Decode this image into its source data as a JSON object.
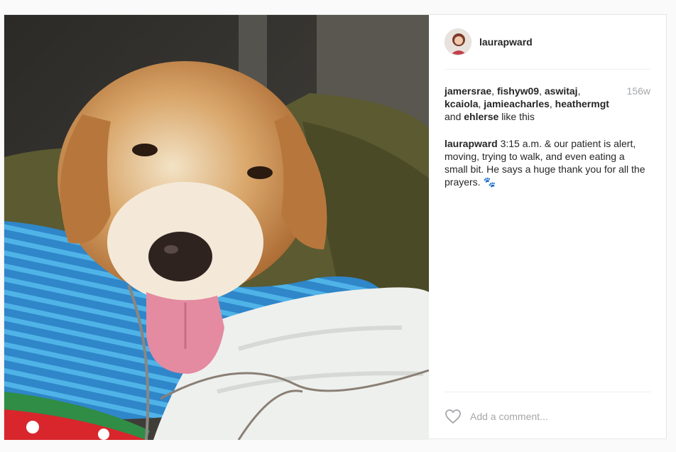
{
  "post": {
    "image_alt": "golden retriever resting on blue striped towel",
    "author": {
      "username": "laurapward"
    },
    "likes": {
      "users": [
        "jamersrae",
        "fishyw09",
        "aswitaj",
        "kcaiola",
        "jamieacharles",
        "heathermgt"
      ],
      "last_user": "ehlerse",
      "joiner": "and",
      "suffix": "like this",
      "u1": "jamersrae",
      "u2": "fishyw09",
      "u3": "aswitaj",
      "u4": "kcaiola",
      "u5": "jamieacharles",
      "u6": "heathermgt",
      "u7": "ehlerse"
    },
    "age": "156w",
    "caption": {
      "username": "laurapward",
      "text": "3:15 a.m. & our patient is alert, moving, trying to walk, and even eating a small bit. He says a huge thank you for all the prayers. 🐾"
    },
    "comment": {
      "placeholder": "Add a comment..."
    },
    "icons": {
      "like": "heart-outline-icon"
    },
    "colors": {
      "username": "#262626",
      "muted": "#a5a7aa",
      "border": "#efefef"
    }
  }
}
